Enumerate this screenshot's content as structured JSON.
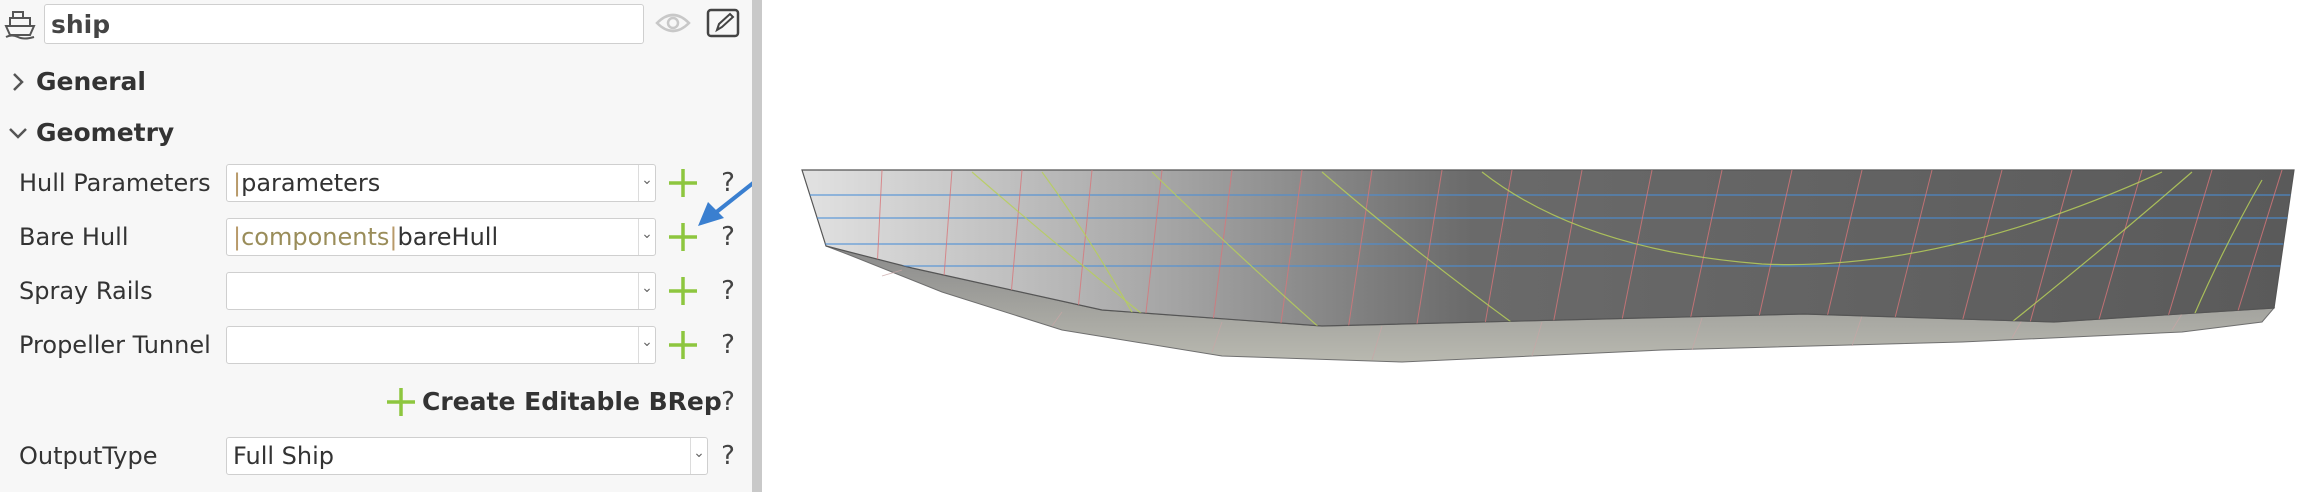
{
  "header": {
    "name_value": "ship",
    "icons": [
      "ship-icon",
      "eye-icon",
      "edit-icon"
    ]
  },
  "sections": {
    "general": "General",
    "geometry": "Geometry"
  },
  "geometry_rows": [
    {
      "label": "Hull Parameters",
      "value": [
        "parameters"
      ]
    },
    {
      "label": "Bare Hull",
      "value": [
        "components",
        "bareHull"
      ]
    },
    {
      "label": "Spray Rails",
      "value": []
    },
    {
      "label": "Propeller Tunnel",
      "value": []
    }
  ],
  "create_button": {
    "label": "Create Editable BRep"
  },
  "output_type": {
    "label": "OutputType",
    "value": "Full Ship"
  },
  "help_symbol": "?",
  "colors": {
    "accent_plus": "#8dc63f",
    "annotation_arrow": "#3a7fd0",
    "reference_text": "#9a8d5a"
  }
}
